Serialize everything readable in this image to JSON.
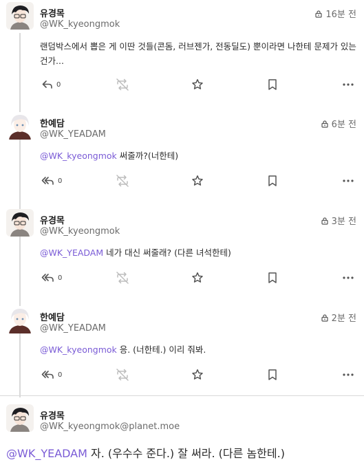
{
  "notes": [
    {
      "name": "유경목",
      "handle": "@WK_kyeongmok",
      "time": "16분 전",
      "text": "랜덤박스에서 뽑은 게 이딴 것들(콘돔, 러브젠가, 전동딜도) 뿐이라면 나한테 문제가 있는 건가...",
      "replies": "0",
      "reply_icon": "reply-icon"
    },
    {
      "name": "한예담",
      "handle": "@WK_YEADAM",
      "time": "6분 전",
      "mention": "@WK_kyeongmok",
      "text": " 써줄까?(너한테)",
      "replies": "0",
      "reply_icon": "reply-all-icon"
    },
    {
      "name": "유경목",
      "handle": "@WK_kyeongmok",
      "time": "3분 전",
      "mention": "@WK_YEADAM",
      "text": " 네가 대신 써줄래? (다른 녀석한테)",
      "replies": "0",
      "reply_icon": "reply-all-icon"
    },
    {
      "name": "한예담",
      "handle": "@WK_YEADAM",
      "time": "2분 전",
      "mention": "@WK_kyeongmok",
      "text": " 응. (너한테.) 이리 줘봐.",
      "replies": "0",
      "reply_icon": "reply-all-icon"
    }
  ],
  "focused": {
    "name": "유경목",
    "handle": "@WK_kyeongmok@planet.moe",
    "mention": "@WK_YEADAM",
    "text": " 자. (우수수 준다.) 잘 써라. (다른 놈한테.)"
  },
  "colors": {
    "mention": "#7a5bd6",
    "muted": "#6b6b6b",
    "icon": "#555555",
    "divider": "#d9d9d9"
  },
  "icons": [
    "lock-icon",
    "reply-icon",
    "reply-all-icon",
    "renote-icon",
    "star-icon",
    "bookmark-icon",
    "more-icon"
  ]
}
